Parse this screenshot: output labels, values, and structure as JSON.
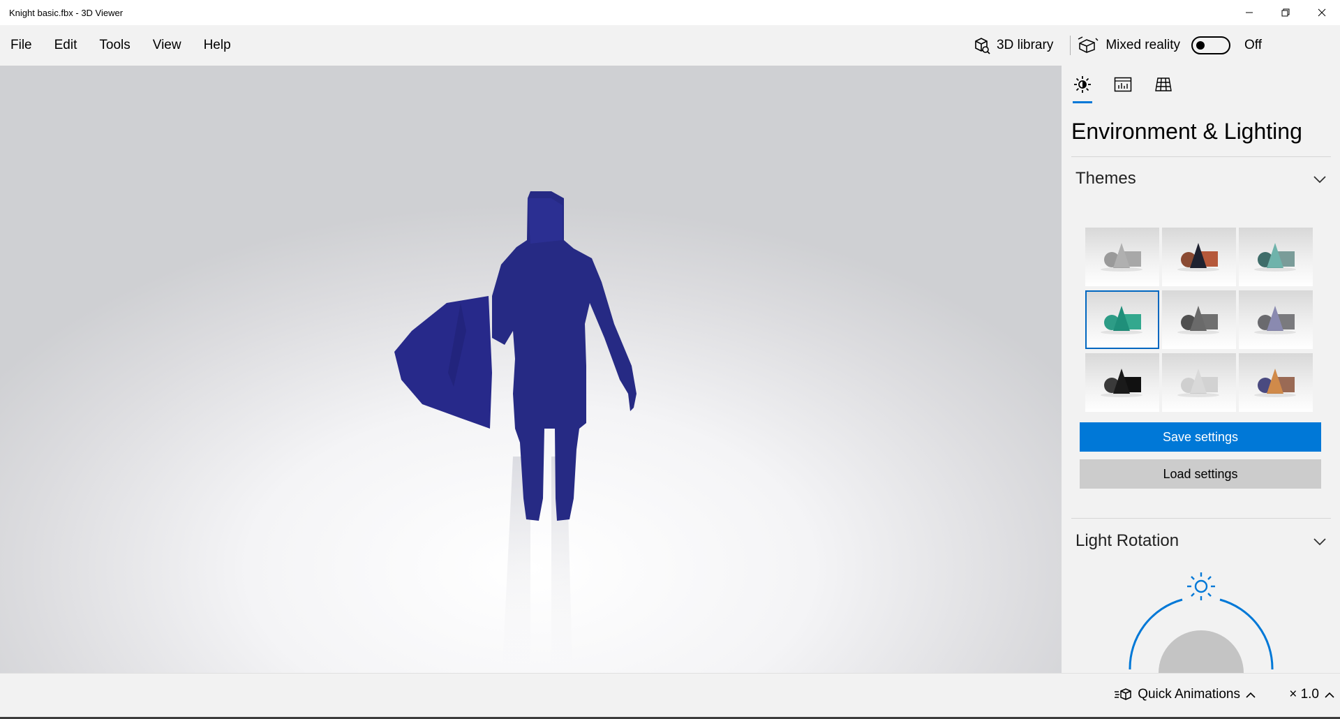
{
  "window": {
    "title": "Knight basic.fbx - 3D Viewer"
  },
  "menu": {
    "items": [
      {
        "label": "File"
      },
      {
        "label": "Edit"
      },
      {
        "label": "Tools"
      },
      {
        "label": "View"
      },
      {
        "label": "Help"
      }
    ],
    "library_label": "3D library",
    "mixed_reality_label": "Mixed reality",
    "mixed_reality_state": "Off"
  },
  "model": {
    "color": "#262a84"
  },
  "panel": {
    "tabs": [
      {
        "icon": "sun-icon",
        "active": true
      },
      {
        "icon": "stats-icon",
        "active": false
      },
      {
        "icon": "grid-icon",
        "active": false
      }
    ],
    "title": "Environment & Lighting",
    "themes_header": "Themes",
    "themes": [
      {
        "name": "theme-1",
        "selected": false
      },
      {
        "name": "theme-2",
        "selected": false
      },
      {
        "name": "theme-3",
        "selected": false
      },
      {
        "name": "theme-4",
        "selected": true
      },
      {
        "name": "theme-5",
        "selected": false
      },
      {
        "name": "theme-6",
        "selected": false
      },
      {
        "name": "theme-7",
        "selected": false
      },
      {
        "name": "theme-8",
        "selected": false
      },
      {
        "name": "theme-9",
        "selected": false
      }
    ],
    "save_label": "Save settings",
    "load_label": "Load settings",
    "light_rotation_header": "Light Rotation"
  },
  "status": {
    "quick_animations_label": "Quick Animations",
    "speed_label": "× 1.0"
  },
  "colors": {
    "accent": "#0078d7",
    "model": "#262a84"
  }
}
